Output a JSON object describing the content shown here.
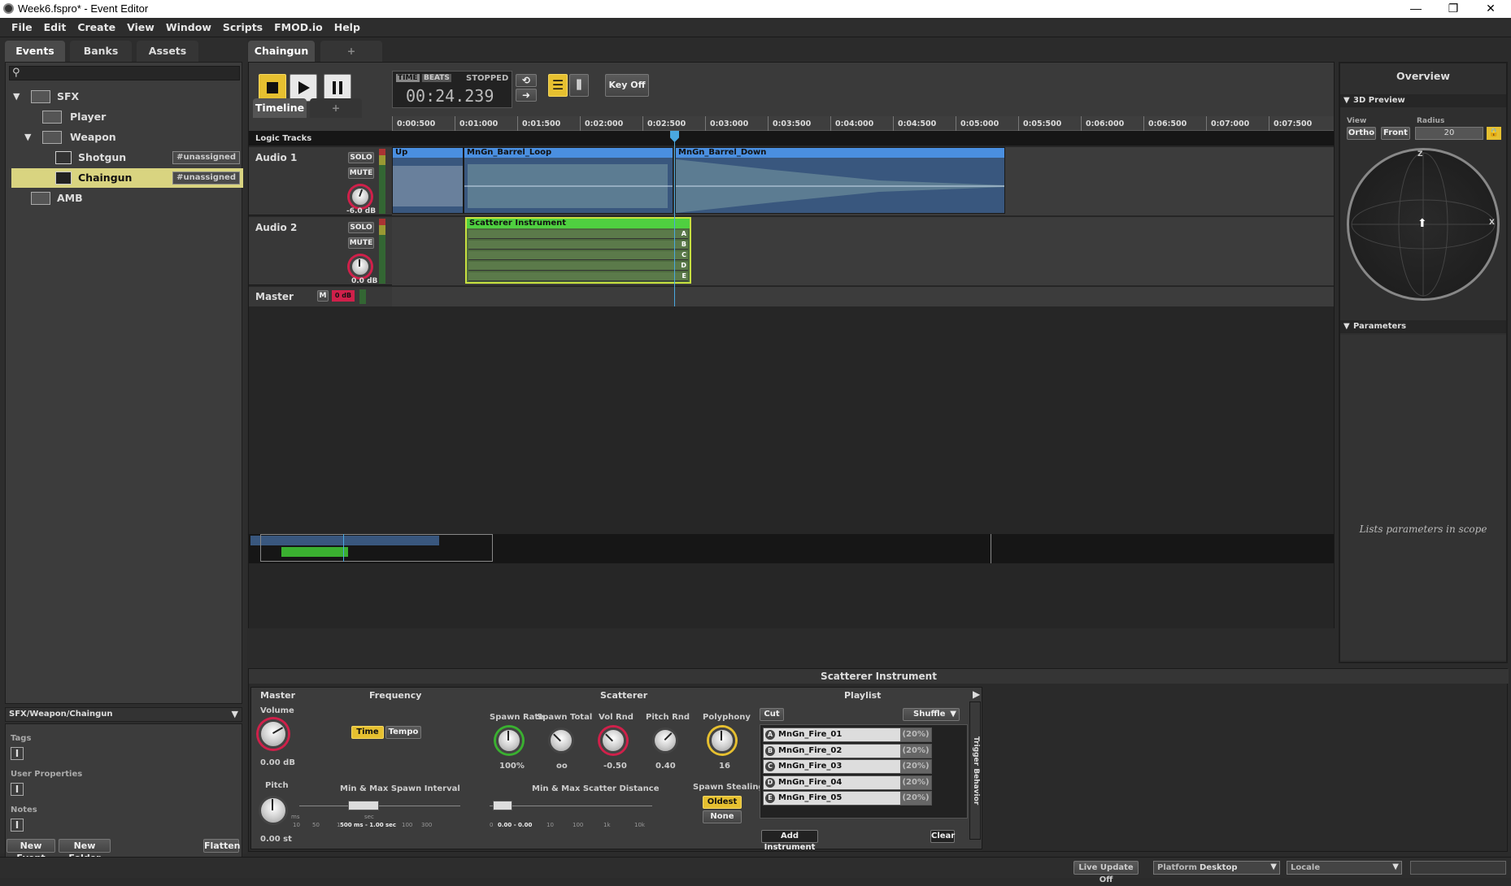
{
  "window": {
    "title": "Week6.fspro* - Event Editor",
    "minimize": "—",
    "restore": "❐",
    "close": "✕"
  },
  "menu": [
    "File",
    "Edit",
    "Create",
    "View",
    "Window",
    "Scripts",
    "FMOD.io",
    "Help"
  ],
  "browser": {
    "tabs": [
      "Events",
      "Banks",
      "Assets"
    ],
    "search_placeholder": "",
    "tree": [
      {
        "label": "SFX",
        "type": "folder",
        "depth": 0,
        "expanded": true
      },
      {
        "label": "Player",
        "type": "folder",
        "depth": 1
      },
      {
        "label": "Weapon",
        "type": "folder",
        "depth": 1,
        "expanded": true
      },
      {
        "label": "Shotgun",
        "type": "event",
        "depth": 2,
        "tag": "#unassigned"
      },
      {
        "label": "Chaingun",
        "type": "event",
        "depth": 2,
        "tag": "#unassigned",
        "selected": true
      },
      {
        "label": "AMB",
        "type": "folder",
        "depth": 0
      }
    ],
    "path": "SFX/Weapon/Chaingun",
    "sections": [
      "Tags",
      "User Properties",
      "Notes"
    ],
    "buttons": {
      "new_event": "New Event",
      "new_folder": "New Folder",
      "flatten": "Flatten"
    }
  },
  "editor": {
    "tabs": {
      "active": "Chaingun",
      "add": "+"
    },
    "transport": {
      "time": "TIME",
      "beats": "BEATS",
      "state": "STOPPED",
      "counter": "00:24.239",
      "key_off": "Key Off"
    },
    "timeline_tab": "Timeline",
    "timeline_add": "+",
    "ruler": [
      "0:00:500",
      "0:01:000",
      "0:01:500",
      "0:02:000",
      "0:02:500",
      "0:03:000",
      "0:03:500",
      "0:04:000",
      "0:04:500",
      "0:05:000",
      "0:05:500",
      "0:06:000",
      "0:06:500",
      "0:07:000",
      "0:07:500"
    ],
    "logic_tracks": "Logic Tracks",
    "tracks": [
      {
        "name": "Audio 1",
        "solo": "SOLO",
        "mute": "MUTE",
        "db": "-6.0 dB"
      },
      {
        "name": "Audio 2",
        "solo": "SOLO",
        "mute": "MUTE",
        "db": "0.0 dB"
      }
    ],
    "master": {
      "name": "Master",
      "m": "M",
      "db": "0 dB"
    },
    "clips": {
      "up": "Up",
      "loop": "MnGn_Barrel_Loop",
      "down": "MnGn_Barrel_Down",
      "scatterer": "Scatterer Instrument",
      "letters": [
        "A",
        "B",
        "C",
        "D",
        "E"
      ]
    }
  },
  "overview": {
    "title": "Overview",
    "preview": "3D Preview",
    "view_label": "View",
    "radius_label": "Radius",
    "ortho": "Ortho",
    "front": "Front",
    "radius": "20",
    "z": "Z",
    "x": "X",
    "parameters": "Parameters",
    "param_hint": "Lists parameters in scope"
  },
  "deck": {
    "title": "Scatterer Instrument",
    "master": "Master",
    "frequency": "Frequency",
    "scatterer": "Scatterer",
    "playlist": "Playlist",
    "volume_label": "Volume",
    "volume": "0.00 dB",
    "pitch_label": "Pitch",
    "pitch": "0.00 st",
    "time": "Time",
    "tempo": "Tempo",
    "spawn_interval": "Min & Max Spawn Interval",
    "interval_ticks": [
      "10",
      "50",
      "100",
      "500",
      "1",
      "5",
      "10",
      "30",
      "100",
      "300"
    ],
    "interval_units": [
      "ms",
      "sec"
    ],
    "interval_value": "500 ms - 1.00 sec",
    "spawn_rate_label": "Spawn Rate",
    "spawn_rate": "100%",
    "spawn_total_label": "Spawn Total",
    "spawn_total": "oo",
    "vol_rnd_label": "Vol Rnd",
    "vol_rnd": "-0.50",
    "pitch_rnd_label": "Pitch Rnd",
    "pitch_rnd": "0.40",
    "scatter_distance": "Min & Max Scatter Distance",
    "distance_ticks": [
      "0",
      "1",
      "10",
      "100",
      "1k",
      "10k"
    ],
    "distance_value": "0.00 - 0.00",
    "polyphony_label": "Polyphony",
    "polyphony": "16",
    "spawn_stealing": "Spawn Stealing",
    "oldest": "Oldest",
    "none": "None",
    "cut": "Cut",
    "shuffle": "Shuffle",
    "items": [
      {
        "letter": "A",
        "name": "MnGn_Fire_01",
        "pct": "(20%)"
      },
      {
        "letter": "B",
        "name": "MnGn_Fire_02",
        "pct": "(20%)"
      },
      {
        "letter": "C",
        "name": "MnGn_Fire_03",
        "pct": "(20%)"
      },
      {
        "letter": "D",
        "name": "MnGn_Fire_04",
        "pct": "(20%)"
      },
      {
        "letter": "E",
        "name": "MnGn_Fire_05",
        "pct": "(20%)"
      }
    ],
    "add_instrument": "Add Instrument",
    "clear": "Clear",
    "trigger_behavior": "Trigger Behavior"
  },
  "statusbar": {
    "live_update": "Live Update Off",
    "platform_label": "Platform",
    "platform": "Desktop",
    "locale_label": "Locale"
  },
  "colors": {
    "accent": "#e6c030",
    "clip_blue": "#4a8fe0",
    "scatter_green": "#4fd040",
    "knob_red": "#d0204a"
  }
}
